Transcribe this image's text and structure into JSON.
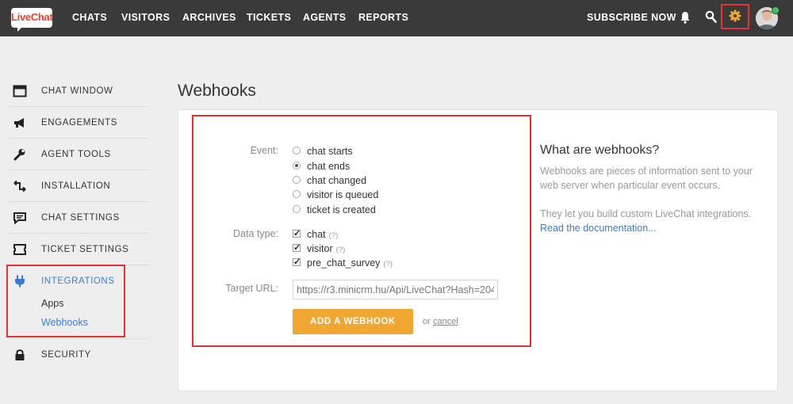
{
  "brand": {
    "logo_text": "LiveChat"
  },
  "nav": {
    "items": [
      "CHATS",
      "VISITORS",
      "ARCHIVES",
      "TICKETS",
      "AGENTS",
      "REPORTS"
    ],
    "subscribe": "SUBSCRIBE NOW"
  },
  "colors": {
    "accent": "#3b7bd8",
    "button": "#f0a732",
    "highlight": "#e63232",
    "topbar": "#3a3a3a"
  },
  "sidebar": {
    "items": [
      {
        "label": "CHAT WINDOW",
        "icon": "window-icon"
      },
      {
        "label": "ENGAGEMENTS",
        "icon": "megaphone-icon"
      },
      {
        "label": "AGENT TOOLS",
        "icon": "wrench-icon"
      },
      {
        "label": "INSTALLATION",
        "icon": "code-icon"
      },
      {
        "label": "CHAT SETTINGS",
        "icon": "chat-bubble-icon"
      },
      {
        "label": "TICKET SETTINGS",
        "icon": "ticket-icon"
      },
      {
        "label": "INTEGRATIONS",
        "icon": "plug-icon"
      },
      {
        "label": "SECURITY",
        "icon": "lock-icon"
      }
    ],
    "sub_items": [
      "Apps",
      "Webhooks"
    ]
  },
  "main": {
    "title": "Webhooks",
    "form": {
      "event_label": "Event:",
      "events": [
        {
          "label": "chat starts",
          "selected": false
        },
        {
          "label": "chat ends",
          "selected": true
        },
        {
          "label": "chat changed",
          "selected": false
        },
        {
          "label": "visitor is queued",
          "selected": false
        },
        {
          "label": "ticket is created",
          "selected": false
        }
      ],
      "data_type_label": "Data type:",
      "data_types": [
        {
          "label": "chat",
          "help": "(?)",
          "checked": true
        },
        {
          "label": "visitor",
          "help": "(?)",
          "checked": true
        },
        {
          "label": "pre_chat_survey",
          "help": "(?)",
          "checked": true
        }
      ],
      "target_url_label": "Target URL:",
      "target_url_value": "https://r3.minicrm.hu/Api/LiveChat?Hash=204",
      "submit_label": "ADD A WEBHOOK",
      "or_text": "or",
      "cancel_label": "cancel"
    },
    "info": {
      "title": "What are webhooks?",
      "p1": "Webhooks are pieces of information sent to your web server when particular event occurs.",
      "p2": "They let you build custom LiveChat integrations.",
      "link": "Read the documentation..."
    }
  }
}
